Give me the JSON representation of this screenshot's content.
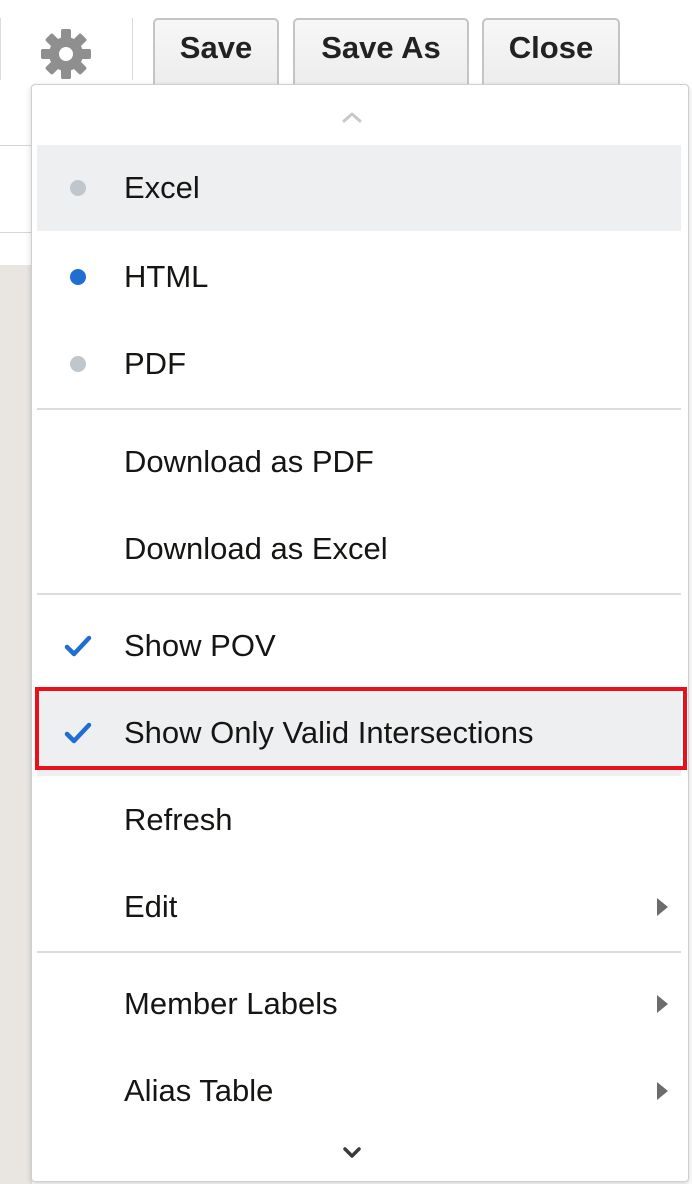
{
  "toolbar": {
    "gear_icon": "gear-icon",
    "save_label": "Save",
    "save_as_label": "Save As",
    "close_label": "Close"
  },
  "menu": {
    "scroll_up_icon": "chevron-up-icon",
    "scroll_down_icon": "chevron-down-icon",
    "format_options": [
      {
        "label": "Excel",
        "selected": false
      },
      {
        "label": "HTML",
        "selected": true
      },
      {
        "label": "PDF",
        "selected": false
      }
    ],
    "download_items": [
      {
        "label": "Download as PDF"
      },
      {
        "label": "Download as Excel"
      }
    ],
    "toggle_items": [
      {
        "label": "Show POV",
        "checked": true
      },
      {
        "label": "Show Only Valid Intersections",
        "checked": true,
        "highlighted": true
      },
      {
        "label": "Refresh",
        "checked": false
      },
      {
        "label": "Edit",
        "checked": false,
        "has_submenu": true
      }
    ],
    "view_items": [
      {
        "label": "Member Labels",
        "has_submenu": true
      },
      {
        "label": "Alias Table",
        "has_submenu": true
      }
    ]
  },
  "colors": {
    "selected_radio": "#1f6fd2",
    "unselected_radio": "#bfc7cd",
    "checkmark": "#1f6fd2",
    "highlight_border": "#e8101a",
    "hover_background": "#edeff0"
  }
}
